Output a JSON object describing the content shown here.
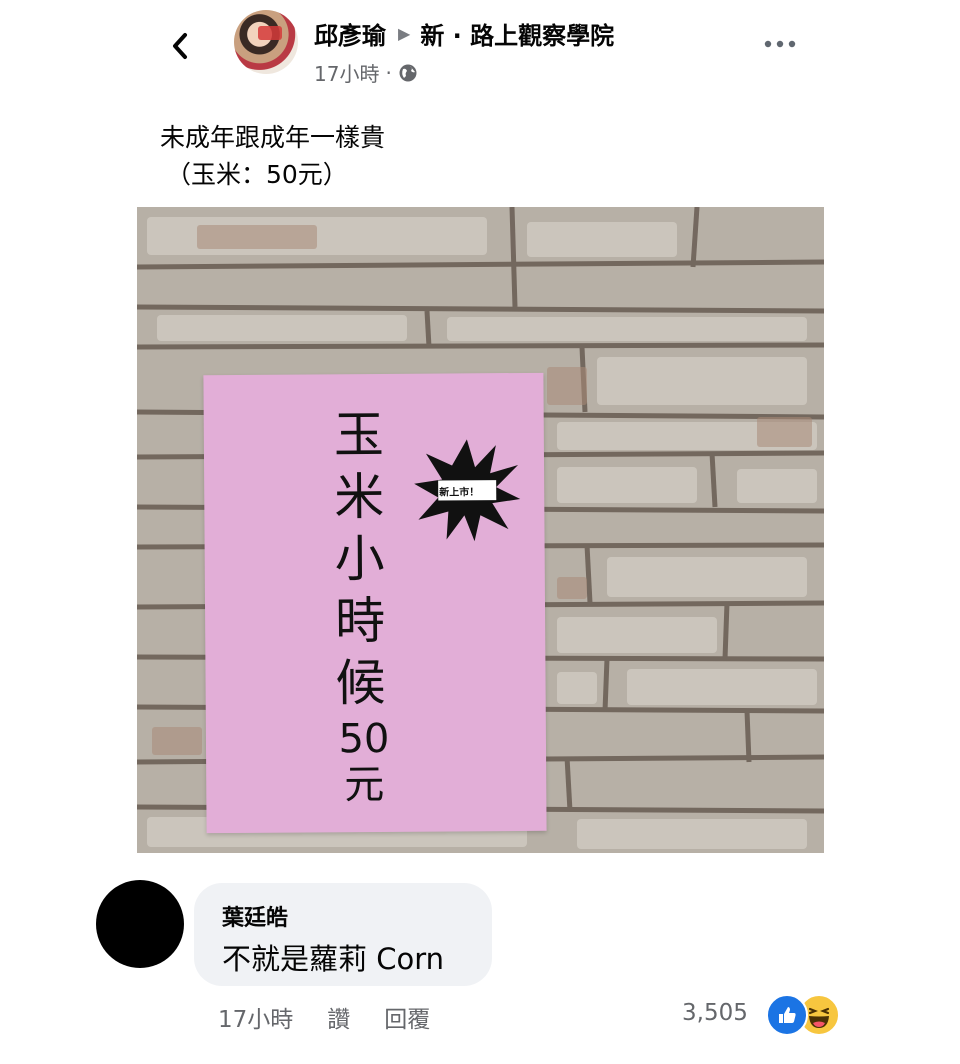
{
  "header": {
    "author": "邱彥瑜",
    "group": "新 · 路上觀察學院",
    "time": "17小時",
    "dot": "·"
  },
  "post": {
    "lines": [
      "未成年跟成年一樣貴",
      "（玉米：50元）"
    ]
  },
  "photo": {
    "sign_chars": [
      "玉",
      "米",
      "小",
      "時",
      "候"
    ],
    "price_number": "50",
    "price_unit": "元",
    "burst_label": "新上市！",
    "colors": {
      "sign": "#e2aed7",
      "wall": "#b8b2a8"
    }
  },
  "comment": {
    "name": "葉廷皓",
    "text": "不就是蘿莉 Corn",
    "time": "17小時",
    "like_label": "讚",
    "reply_label": "回覆",
    "reaction_count": "3,505",
    "reactions": [
      "like-icon",
      "haha-icon"
    ]
  }
}
